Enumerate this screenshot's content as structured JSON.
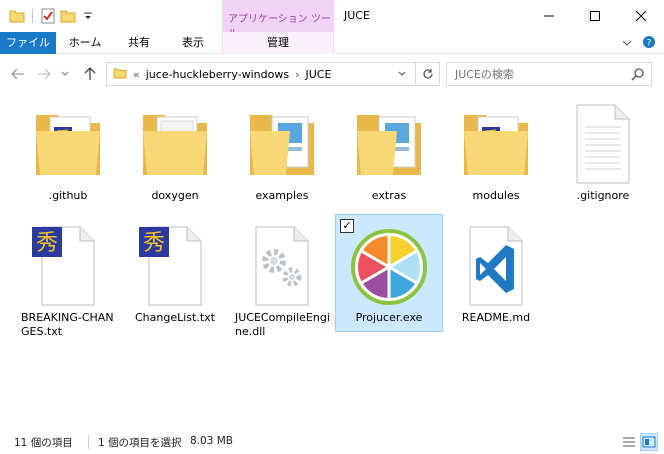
{
  "window": {
    "title": "JUCE",
    "context_tab_group": "アプリケーション ツール"
  },
  "ribbon": {
    "tabs": [
      {
        "label": "ファイル"
      },
      {
        "label": "ホーム"
      },
      {
        "label": "共有"
      },
      {
        "label": "表示"
      },
      {
        "label": "管理"
      }
    ]
  },
  "address": {
    "overflow": "«",
    "crumbs": [
      "juce-huckleberry-windows",
      "JUCE"
    ],
    "separator": "›"
  },
  "search": {
    "placeholder": "JUCEの検索"
  },
  "files": [
    {
      "name": ".github",
      "icon": "folder-icon"
    },
    {
      "name": "doxygen",
      "icon": "folder-icon"
    },
    {
      "name": "examples",
      "icon": "folder-icon"
    },
    {
      "name": "extras",
      "icon": "folder-icon"
    },
    {
      "name": "modules",
      "icon": "folder-icon"
    },
    {
      "name": ".gitignore",
      "icon": "text-file-icon"
    },
    {
      "name": "BREAKING-CHANGES.txt",
      "icon": "hidemaru-file-icon"
    },
    {
      "name": "ChangeList.txt",
      "icon": "hidemaru-file-icon"
    },
    {
      "name": "JUCECompileEngine.dll",
      "icon": "dll-file-icon"
    },
    {
      "name": "Projucer.exe",
      "icon": "projucer-app-icon",
      "selected": true
    },
    {
      "name": "README.md",
      "icon": "vscode-file-icon"
    }
  ],
  "status": {
    "item_count": "11 個の項目",
    "selection": "1 個の項目を選択",
    "size": "8.03 MB"
  },
  "colors": {
    "accent": "#1979ca",
    "selection_bg": "#cce8ff",
    "selection_border": "#99d1ff",
    "folder": "#f8d775"
  }
}
